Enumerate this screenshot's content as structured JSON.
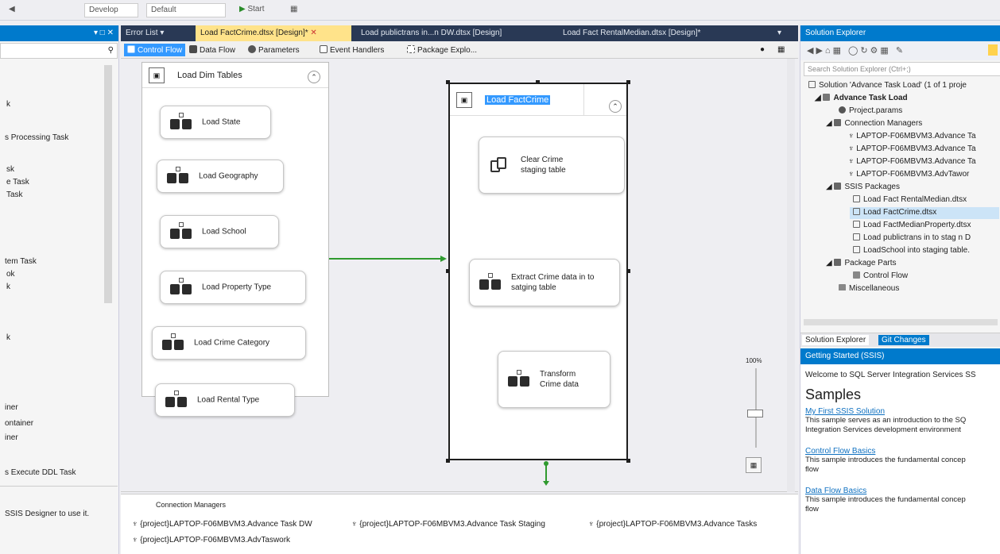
{
  "toolbar": {
    "config_value": "Develop",
    "platform_value": "Default",
    "start_label": "Start"
  },
  "left_panel": {
    "items": [
      "k",
      "s Processing Task",
      "sk",
      "e Task",
      "Task",
      "tem Task",
      "ok",
      "k",
      "k",
      "iner",
      "ontainer",
      "iner",
      "s Execute DDL Task",
      "SSIS Designer to use it."
    ]
  },
  "tabs": [
    {
      "label": "Error List"
    },
    {
      "label": "Load FactCrime.dtsx [Design]*"
    },
    {
      "label": "Load publictrans in...n DW.dtsx [Design]"
    },
    {
      "label": "Load Fact RentalMedian.dtsx [Design]*"
    }
  ],
  "designer_tabs": [
    "Control Flow",
    "Data Flow",
    "Parameters",
    "Event Handlers",
    "Package Explo..."
  ],
  "containers": {
    "dim": {
      "title": "Load Dim Tables"
    },
    "fact": {
      "title": "Load FactCrime"
    }
  },
  "dim_tasks": [
    "Load State",
    "Load Geography",
    "Load School",
    "Load Property Type",
    "Load Crime Category",
    "Load Rental Type"
  ],
  "fact_tasks": [
    "Clear Crime staging table",
    "Extract Crime data in to satging table",
    "Transform Crime data"
  ],
  "zoom": {
    "value": "100%"
  },
  "connection_managers": {
    "title": "Connection Managers",
    "items": [
      "{project}LAPTOP-F06MBVM3.Advance Task DW",
      "{project}LAPTOP-F06MBVM3.Advance Task Staging",
      "{project}LAPTOP-F06MBVM3.Advance Tasks",
      "{project}LAPTOP-F06MBVM3.AdvTaswork"
    ]
  },
  "solution_explorer": {
    "title": "Solution Explorer",
    "search_placeholder": "Search Solution Explorer (Ctrl+;)",
    "tree": [
      {
        "label": "Solution 'Advance Task Load' (1 of 1 proje"
      },
      {
        "label": "Advance Task Load"
      },
      {
        "label": "Project.params"
      },
      {
        "label": "Connection Managers"
      },
      {
        "label": "LAPTOP-F06MBVM3.Advance Ta"
      },
      {
        "label": "LAPTOP-F06MBVM3.Advance Ta"
      },
      {
        "label": "LAPTOP-F06MBVM3.Advance Ta"
      },
      {
        "label": "LAPTOP-F06MBVM3.AdvTawor"
      },
      {
        "label": "SSIS Packages"
      },
      {
        "label": "Load Fact RentalMedian.dtsx"
      },
      {
        "label": "Load FactCrime.dtsx"
      },
      {
        "label": "Load FactMedianProperty.dtsx"
      },
      {
        "label": "Load publictrans in to stag n D"
      },
      {
        "label": "LoadSchool into staging table."
      },
      {
        "label": "Package Parts"
      },
      {
        "label": "Control Flow"
      },
      {
        "label": "Miscellaneous"
      }
    ],
    "tab_solution": "Solution Explorer",
    "tab_git": "Git Changes"
  },
  "getting_started": {
    "title": "Getting Started (SSIS)",
    "welcome": "Welcome to SQL Server Integration Services SS",
    "samples_heading": "Samples",
    "links": [
      {
        "title": "My First SSIS Solution",
        "desc1": "This sample serves as an introduction to the SQ",
        "desc2": "Integration Services development environment"
      },
      {
        "title": "Control Flow Basics",
        "desc1": "This sample introduces the fundamental concep",
        "desc2": "flow"
      },
      {
        "title": "Data Flow Basics",
        "desc1": "This sample introduces the fundamental concep",
        "desc2": "flow"
      }
    ]
  }
}
